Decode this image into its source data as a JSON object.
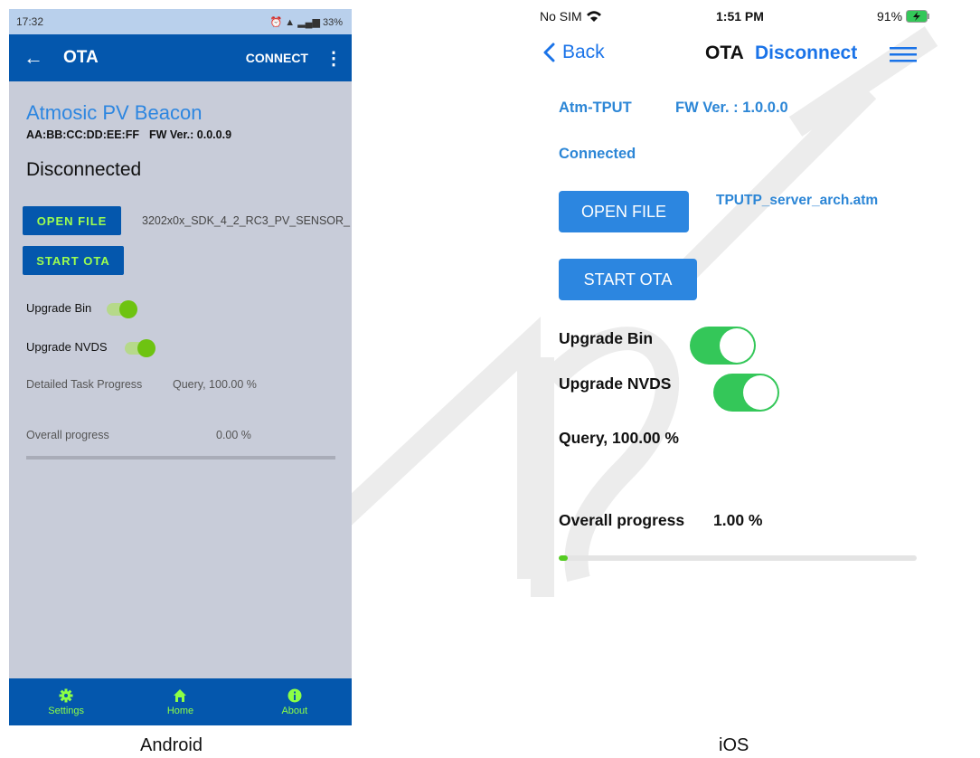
{
  "android": {
    "status": {
      "time": "17:32",
      "right": "33%"
    },
    "appbar": {
      "title": "OTA",
      "connect": "CONNECT"
    },
    "device_name": "Atmosic PV Beacon",
    "address": "AA:BB:CC:DD:EE:FF",
    "fw_version": "FW Ver.: 0.0.0.9",
    "connection_state": "Disconnected",
    "open_file_label": "OPEN FILE",
    "file_name": "3202x0x_SDK_4_2_RC3_PV_SENSOR_",
    "start_ota_label": "START OTA",
    "upgrade_bin_label": "Upgrade Bin",
    "upgrade_bin_on": true,
    "upgrade_nvds_label": "Upgrade NVDS",
    "upgrade_nvds_on": true,
    "detailed_label": "Detailed Task Progress",
    "detailed_value": "Query, 100.00 %",
    "overall_label": "Overall progress",
    "overall_value": "0.00 %",
    "overall_fraction": 0.0,
    "tabs": [
      {
        "label": "Settings",
        "icon": "gear-icon"
      },
      {
        "label": "Home",
        "icon": "home-icon"
      },
      {
        "label": "About",
        "icon": "info-icon"
      }
    ],
    "accent": "#0457ad",
    "tab_color": "#8cff45"
  },
  "ios": {
    "status": {
      "carrier": "No SIM",
      "time": "1:51 PM",
      "battery": "91%"
    },
    "nav": {
      "back": "Back",
      "title": "OTA",
      "disconnect": "Disconnect"
    },
    "device_name": "Atm-TPUT",
    "fw_version": "FW Ver. : 1.0.0.0",
    "connection_state": "Connected",
    "open_file_label": "OPEN FILE",
    "file_name": "TPUTP_server_arch.atm",
    "start_ota_label": "START OTA",
    "upgrade_bin_label": "Upgrade Bin",
    "upgrade_bin_on": true,
    "upgrade_nvds_label": "Upgrade NVDS",
    "upgrade_nvds_on": true,
    "task_progress": "Query, 100.00 %",
    "overall_label": "Overall progress",
    "overall_value": "1.00 %",
    "overall_fraction": 0.01,
    "accent": "#2c86e0",
    "toggle_color": "#34c759"
  },
  "captions": {
    "android": "Android",
    "ios": "iOS"
  }
}
